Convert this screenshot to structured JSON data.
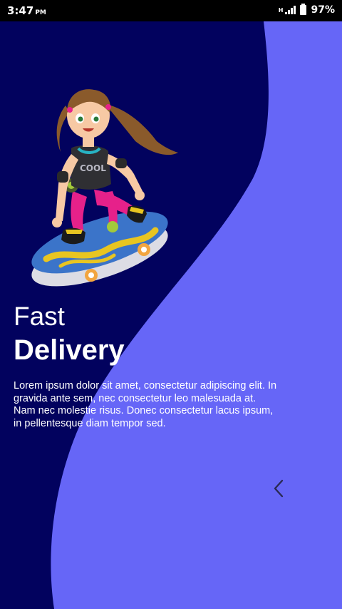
{
  "status_bar": {
    "time": "3:47",
    "ampm": "PM",
    "network_type": "H",
    "battery_percent": "97%"
  },
  "colors": {
    "dark_background": "#02025e",
    "wave_accent": "#6666f7",
    "status_bar": "#000000",
    "text": "#ffffff"
  },
  "onboarding": {
    "title_light": "Fast",
    "title_bold": "Delivery",
    "description": "Lorem ipsum dolor sit amet, consectetur adipiscing elit. In gravida ante sem, nec consectetur leo malesuada at. Nam nec molestie risus. Donec consectetur lacus ipsum, in pellentesque diam tempor sed.",
    "illustration": "girl-on-skateboard-illustration",
    "prev_icon": "chevron-left-icon"
  }
}
